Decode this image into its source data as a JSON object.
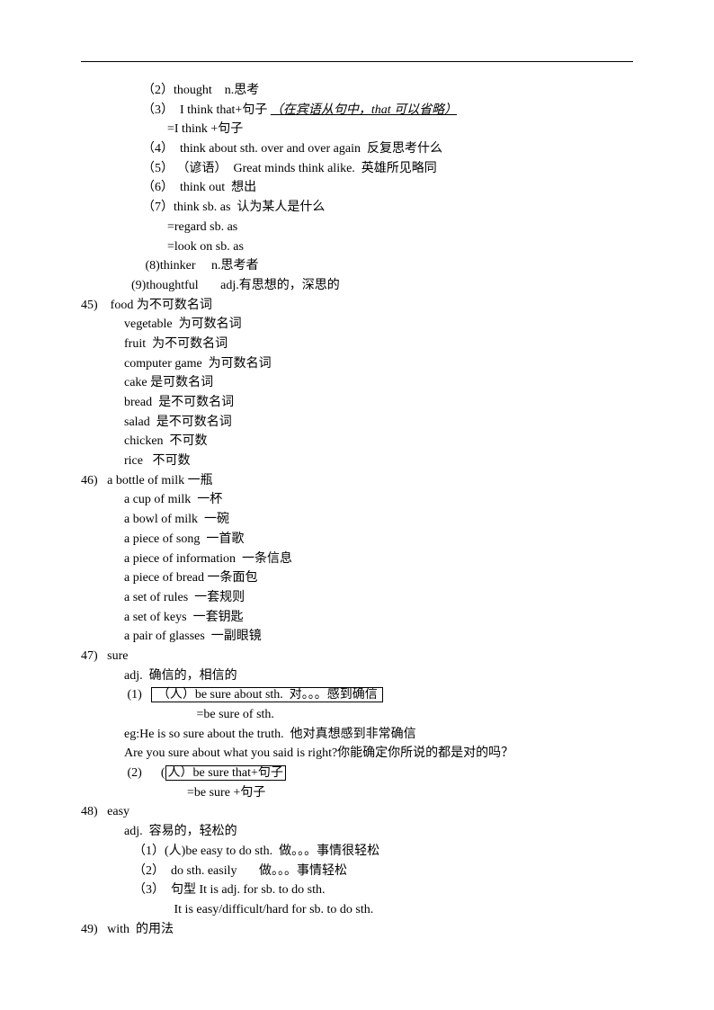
{
  "lines": {
    "l1a": "（2）thought    n.思考",
    "l1b": "（3）  I think that+句子 ",
    "l1bu": "（在宾语从句中，that 可以省略）",
    "l1c": "        =I think +句子",
    "l1d": "（4）  think about sth. over and over again  反复思考什么",
    "l1e": "（5） （谚语）  Great minds think alike.  英雄所见略同",
    "l1f": "（6）  think out  想出",
    "l1g": "（7）think sb. as  认为某人是什么",
    "l1h": "        =regard sb. as",
    "l1i": "        =look on sb. as",
    "l1j": " (8)thinker     n.思考者",
    "l1k": "(9)thoughtful       adj.有思想的，深思的",
    "s45_h": "45)    food 为不可数名词",
    "s45_a": "vegetable  为可数名词",
    "s45_b": "fruit  为不可数名词",
    "s45_c": "computer game  为可数名词",
    "s45_d": "cake 是可数名词",
    "s45_e": "bread  是不可数名词",
    "s45_f": "salad  是不可数名词",
    "s45_g": "chicken  不可数",
    "s45_h2": "rice   不可数",
    "s46_h": "46)   a bottle of milk 一瓶",
    "s46_a": "a cup of milk  一杯",
    "s46_b": "a bowl of milk  一碗",
    "s46_c": "a piece of song  一首歌",
    "s46_d": "a piece of information  一条信息",
    "s46_e": "a piece of bread 一条面包",
    "s46_f": "a set of rules  一套规则",
    "s46_g": "a set of keys  一套钥匙",
    "s46_h2": "a pair of glasses  一副眼镜",
    "s47_h": "47)   sure",
    "s47_a": "adj.  确信的，相信的",
    "s47_b1": " (1)   ",
    "s47_b1_box": " （人）be sure about sth.  对。。。感到确信 ",
    "s47_b2": "                       =be sure of sth.",
    "s47_c": "eg:He is so sure about the truth.  他对真想感到非常确信",
    "s47_d": "Are you sure about what you said is right?你能确定你所说的都是对的吗？",
    "s47_e1": " (2)      (",
    "s47_e1_box": "人）be sure that+句子",
    "s47_e2": "                    =be sure +句子",
    "s48_h": "48)   easy",
    "s48_a": "adj.  容易的，轻松的",
    "s48_b": "（1）(人)be easy to do sth.  做。。。事情很轻松",
    "s48_c": "（2）  do sth. easily       做。。。事情轻松",
    "s48_d": "（3）  句型 It is adj. for sb. to do sth.",
    "s48_e": "             It is easy/difficult/hard for sb. to do sth.",
    "s49_h": "49)   with  的用法"
  }
}
